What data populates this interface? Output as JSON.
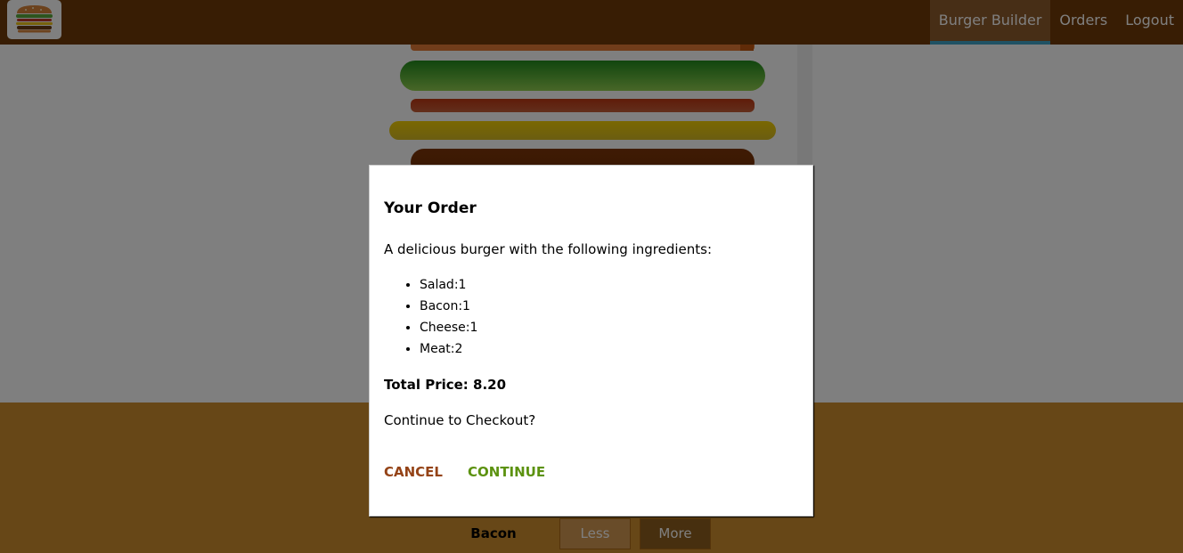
{
  "toolbar": {
    "logo_icon": "burger-logo-icon",
    "nav": [
      {
        "label": "Burger Builder",
        "active": true
      },
      {
        "label": "Orders",
        "active": false
      },
      {
        "label": "Logout",
        "active": false
      }
    ]
  },
  "burger": {
    "ingredients": [
      "bread-top",
      "salad",
      "bacon",
      "cheese",
      "meat"
    ]
  },
  "build_controls": {
    "visible_control": {
      "label": "Bacon",
      "less_label": "Less",
      "more_label": "More"
    }
  },
  "modal": {
    "title": "Your Order",
    "intro": "A delicious burger with the following ingredients:",
    "ingredients": [
      {
        "label": "Salad:1"
      },
      {
        "label": "Bacon:1"
      },
      {
        "label": "Cheese:1"
      },
      {
        "label": "Meat:2"
      }
    ],
    "total_price": "Total Price: 8.20",
    "question": "Continue to Checkout?",
    "cancel_label": "CANCEL",
    "continue_label": "CONTINUE"
  },
  "colors": {
    "toolbar_bg": "#703b09",
    "active_nav_bg": "#8f5c2c",
    "active_nav_underline": "#40a4c8",
    "controls_bg": "#cf8f2e",
    "cancel": "#944317",
    "continue": "#5c9210"
  }
}
